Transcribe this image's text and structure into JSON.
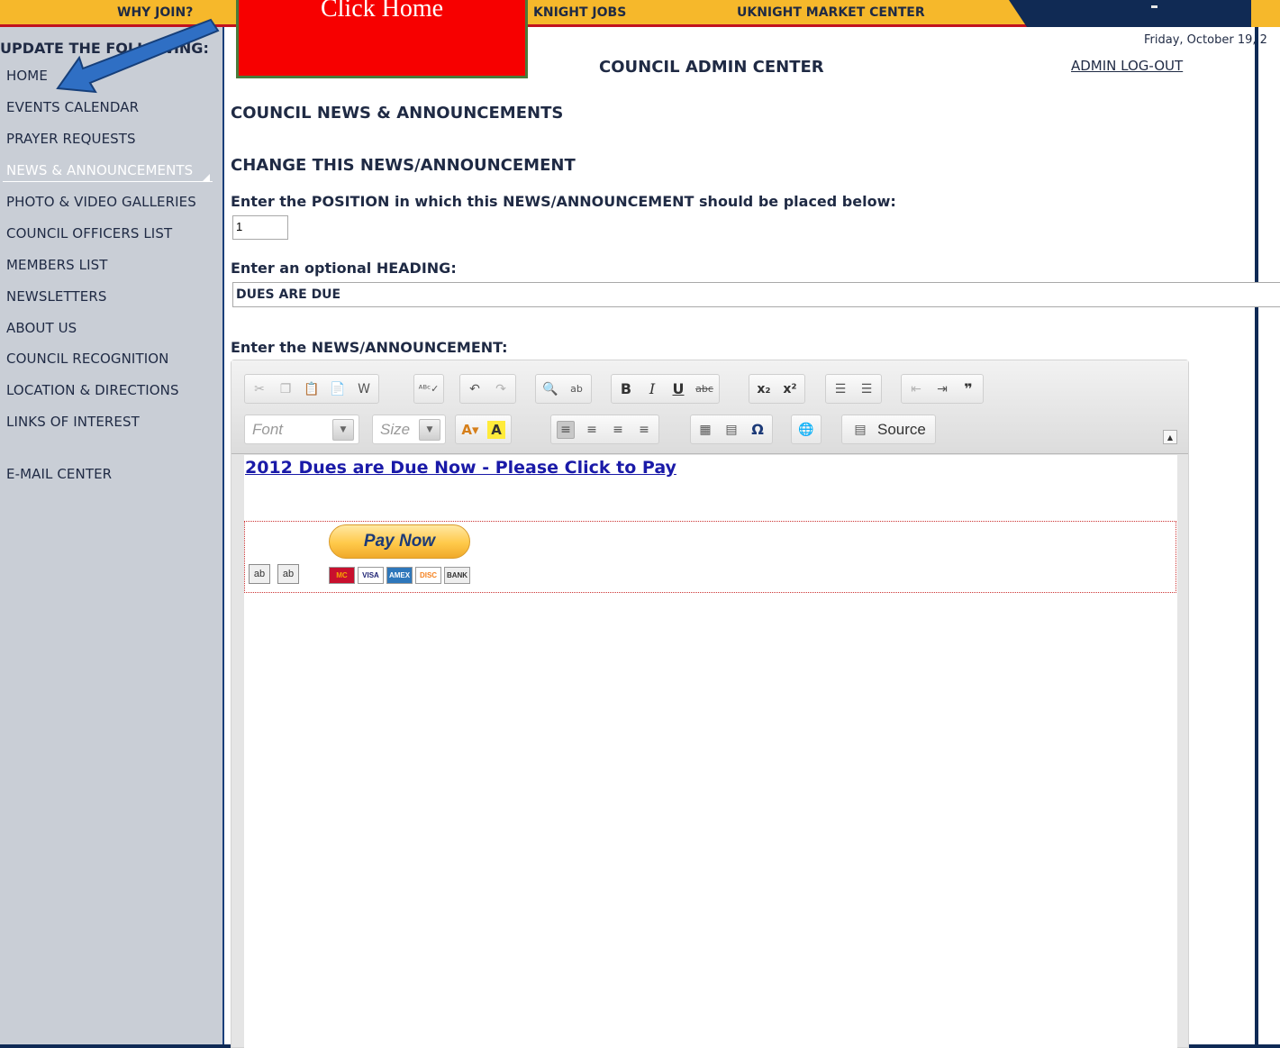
{
  "topnav": {
    "why_join": "WHY JOIN?",
    "knight_jobs": "KNIGHT JOBS",
    "market_center": "UKNIGHT MARKET CENTER"
  },
  "annotation": {
    "callout_text": "Click Home"
  },
  "sidebar": {
    "header": "UPDATE THE FOLLOWING:",
    "items": [
      {
        "label": "HOME"
      },
      {
        "label": "EVENTS CALENDAR"
      },
      {
        "label": "PRAYER REQUESTS"
      },
      {
        "label": "NEWS & ANNOUNCEMENTS",
        "active": true
      },
      {
        "label": "PHOTO & VIDEO GALLERIES"
      },
      {
        "label": "COUNCIL OFFICERS LIST"
      },
      {
        "label": "MEMBERS LIST"
      },
      {
        "label": "NEWSLETTERS"
      },
      {
        "label": "ABOUT US"
      },
      {
        "label": "COUNCIL RECOGNITION"
      },
      {
        "label": "LOCATION & DIRECTIONS"
      },
      {
        "label": "LINKS OF INTEREST"
      },
      {
        "label": "E-MAIL CENTER"
      }
    ]
  },
  "header": {
    "date": "Friday, October 19, 2",
    "title": "COUNCIL ADMIN CENTER",
    "logout": "ADMIN LOG-OUT"
  },
  "main": {
    "section_title": "COUNCIL NEWS & ANNOUNCEMENTS",
    "subsection_title": "CHANGE THIS NEWS/ANNOUNCEMENT",
    "position_label": "Enter the POSITION in which this NEWS/ANNOUNCEMENT should be placed below:",
    "position_value": "1",
    "heading_label": "Enter an optional HEADING:",
    "heading_value": "DUES ARE DUE",
    "announcement_label": "Enter the NEWS/ANNOUNCEMENT:"
  },
  "editor": {
    "font_placeholder": "Font",
    "size_placeholder": "Size",
    "source_label": "Source",
    "content_link": "2012 Dues are Due Now - Please Click to Pay",
    "paynow_label": "Pay Now",
    "hidden_field_label": "ab",
    "cards": [
      "MasterCard",
      "VISA",
      "AMEX",
      "DISCOVER",
      "BANK"
    ]
  },
  "colors": {
    "nav_yellow": "#f6b82b",
    "navy": "#0f2a55",
    "sidebar_bg": "#c9ced6",
    "text_navy": "#1f2a44",
    "callout_red": "#f70000",
    "arrow_blue": "#2f6fc4",
    "link_blue": "#1a1aa8"
  }
}
